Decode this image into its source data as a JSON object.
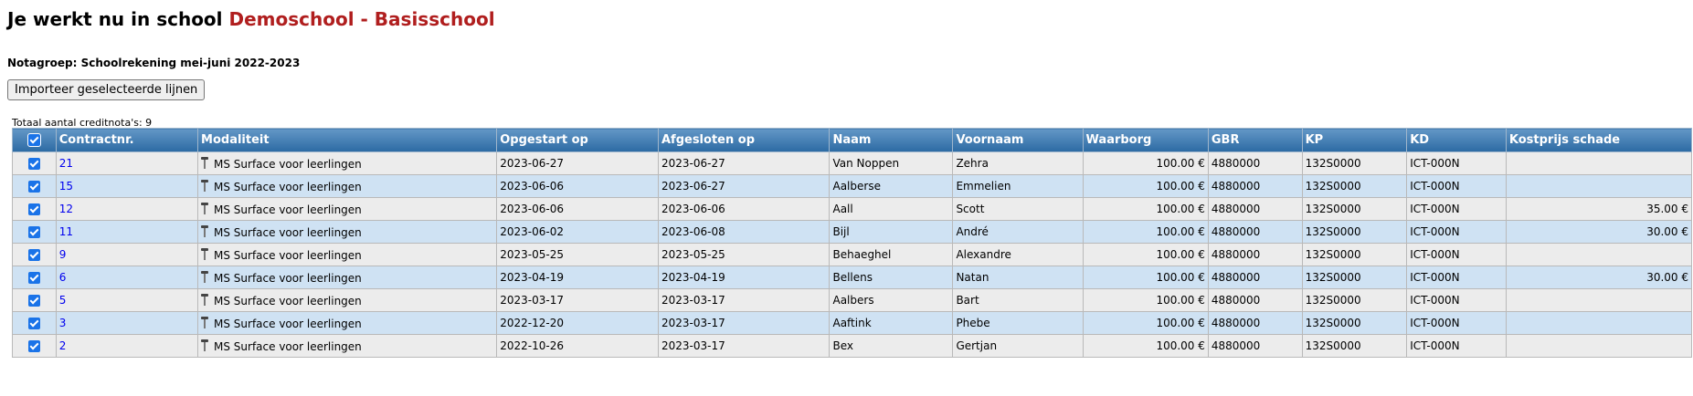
{
  "header": {
    "title_prefix": "Je werkt nu in school",
    "school_name": "Demoschool - Basisschool"
  },
  "notagroep": "Notagroep: Schoolrekening mei-juni 2022-2023",
  "import_button_label": "Importeer geselecteerde lijnen",
  "total_label": "Totaal aantal creditnota's: 9",
  "table": {
    "columns": [
      "Contractnr.",
      "Modaliteit",
      "Opgestart op",
      "Afgesloten op",
      "Naam",
      "Voornaam",
      "Waarborg",
      "GBR",
      "KP",
      "KD",
      "Kostprijs schade"
    ],
    "rows": [
      {
        "contract": "21",
        "modaliteit": "MS Surface voor leerlingen",
        "opgestart": "2023-06-27",
        "afgesloten": "2023-06-27",
        "naam": "Van Noppen",
        "voornaam": "Zehra",
        "waarborg": "100.00 €",
        "gbr": "4880000",
        "kp": "132S0000",
        "kd": "ICT-000N",
        "schade": ""
      },
      {
        "contract": "15",
        "modaliteit": "MS Surface voor leerlingen",
        "opgestart": "2023-06-06",
        "afgesloten": "2023-06-27",
        "naam": "Aalberse",
        "voornaam": "Emmelien",
        "waarborg": "100.00 €",
        "gbr": "4880000",
        "kp": "132S0000",
        "kd": "ICT-000N",
        "schade": ""
      },
      {
        "contract": "12",
        "modaliteit": "MS Surface voor leerlingen",
        "opgestart": "2023-06-06",
        "afgesloten": "2023-06-06",
        "naam": "Aall",
        "voornaam": "Scott",
        "waarborg": "100.00 €",
        "gbr": "4880000",
        "kp": "132S0000",
        "kd": "ICT-000N",
        "schade": "35.00 €"
      },
      {
        "contract": "11",
        "modaliteit": "MS Surface voor leerlingen",
        "opgestart": "2023-06-02",
        "afgesloten": "2023-06-08",
        "naam": "Bijl",
        "voornaam": "André",
        "waarborg": "100.00 €",
        "gbr": "4880000",
        "kp": "132S0000",
        "kd": "ICT-000N",
        "schade": "30.00 €"
      },
      {
        "contract": "9",
        "modaliteit": "MS Surface voor leerlingen",
        "opgestart": "2023-05-25",
        "afgesloten": "2023-05-25",
        "naam": "Behaeghel",
        "voornaam": "Alexandre",
        "waarborg": "100.00 €",
        "gbr": "4880000",
        "kp": "132S0000",
        "kd": "ICT-000N",
        "schade": ""
      },
      {
        "contract": "6",
        "modaliteit": "MS Surface voor leerlingen",
        "opgestart": "2023-04-19",
        "afgesloten": "2023-04-19",
        "naam": "Bellens",
        "voornaam": "Natan",
        "waarborg": "100.00 €",
        "gbr": "4880000",
        "kp": "132S0000",
        "kd": "ICT-000N",
        "schade": "30.00 €"
      },
      {
        "contract": "5",
        "modaliteit": "MS Surface voor leerlingen",
        "opgestart": "2023-03-17",
        "afgesloten": "2023-03-17",
        "naam": "Aalbers",
        "voornaam": "Bart",
        "waarborg": "100.00 €",
        "gbr": "4880000",
        "kp": "132S0000",
        "kd": "ICT-000N",
        "schade": ""
      },
      {
        "contract": "3",
        "modaliteit": "MS Surface voor leerlingen",
        "opgestart": "2022-12-20",
        "afgesloten": "2023-03-17",
        "naam": "Aaftink",
        "voornaam": "Phebe",
        "waarborg": "100.00 €",
        "gbr": "4880000",
        "kp": "132S0000",
        "kd": "ICT-000N",
        "schade": ""
      },
      {
        "contract": "2",
        "modaliteit": "MS Surface voor leerlingen",
        "opgestart": "2022-10-26",
        "afgesloten": "2023-03-17",
        "naam": "Bex",
        "voornaam": "Gertjan",
        "waarborg": "100.00 €",
        "gbr": "4880000",
        "kp": "132S0000",
        "kd": "ICT-000N",
        "schade": ""
      }
    ]
  },
  "icons": {
    "checkbox": "checkbox-checked-icon",
    "modaliteit": "surface-device-icon"
  },
  "colors": {
    "school_name": "#b01e1e",
    "header_bg": "#2c6aa3",
    "row_odd": "#ececec",
    "row_even": "#cfe2f3",
    "link": "#0000ee",
    "checkbox": "#1a73e8"
  }
}
